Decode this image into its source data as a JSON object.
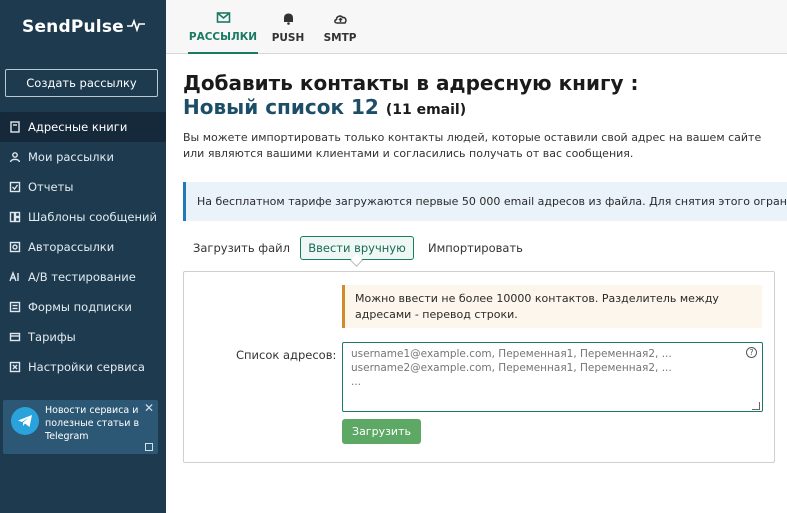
{
  "brand": {
    "logo_text": "SendPulse",
    "logo_mark": "~↙"
  },
  "sidebar": {
    "create_button": "Создать рассылку",
    "items": [
      {
        "label": "Адресные книги",
        "icon": "address-book-icon",
        "active": true
      },
      {
        "label": "Мои рассылки",
        "icon": "users-icon"
      },
      {
        "label": "Отчеты",
        "icon": "check-square-icon"
      },
      {
        "label": "Шаблоны сообщений",
        "icon": "grid-icon"
      },
      {
        "label": "Авторассылки",
        "icon": "auto-icon"
      },
      {
        "label": "A/B тестирование",
        "icon": "ab-test-icon"
      },
      {
        "label": "Формы подписки",
        "icon": "form-icon"
      },
      {
        "label": "Тарифы",
        "icon": "tariff-icon"
      },
      {
        "label": "Настройки сервиса",
        "icon": "settings-icon"
      }
    ],
    "telegram_text": "Новости сервиса и полезные статьи в Telegram"
  },
  "topbar": {
    "tabs": [
      {
        "label": "РАССЫЛКИ",
        "icon": "mail-icon",
        "active": true
      },
      {
        "label": "PUSH",
        "icon": "bell-icon"
      },
      {
        "label": "SMTP",
        "icon": "cloud-upload-icon"
      }
    ]
  },
  "main": {
    "title": "Добавить контакты в адресную книгу :",
    "list_name": "Новый список 12",
    "list_count": "(11 email)",
    "description": "Вы можете импортировать только контакты людей, которые оставили свой адрес на вашем сайте или являются вашими клиентами и согласились получать от вас сообщения.",
    "info_banner": "На бесплатном тарифе загружаются первые 50 000 email адресов из файла. Для снятия этого ограничения необходимо",
    "subtabs": {
      "file": "Загрузить файл",
      "manual": "Ввести вручную",
      "import": "Импортировать"
    },
    "warning": "Можно ввести не более 10000 контактов. Разделитель между адресами - перевод строки.",
    "address_label": "Список адресов:",
    "textarea_placeholder": "username1@example.com, Переменная1, Переменная2, ...\nusername2@example.com, Переменная1, Переменная2, ...\n...",
    "help_glyph": "?",
    "upload_button": "Загрузить"
  },
  "colors": {
    "sidebar_bg": "#1d3a4f",
    "accent_green": "#1a7a63",
    "button_green": "#5ea866",
    "title_blue": "#1d4e68",
    "info_blue": "#1e7bb8",
    "warn_orange": "#d28a2a"
  }
}
